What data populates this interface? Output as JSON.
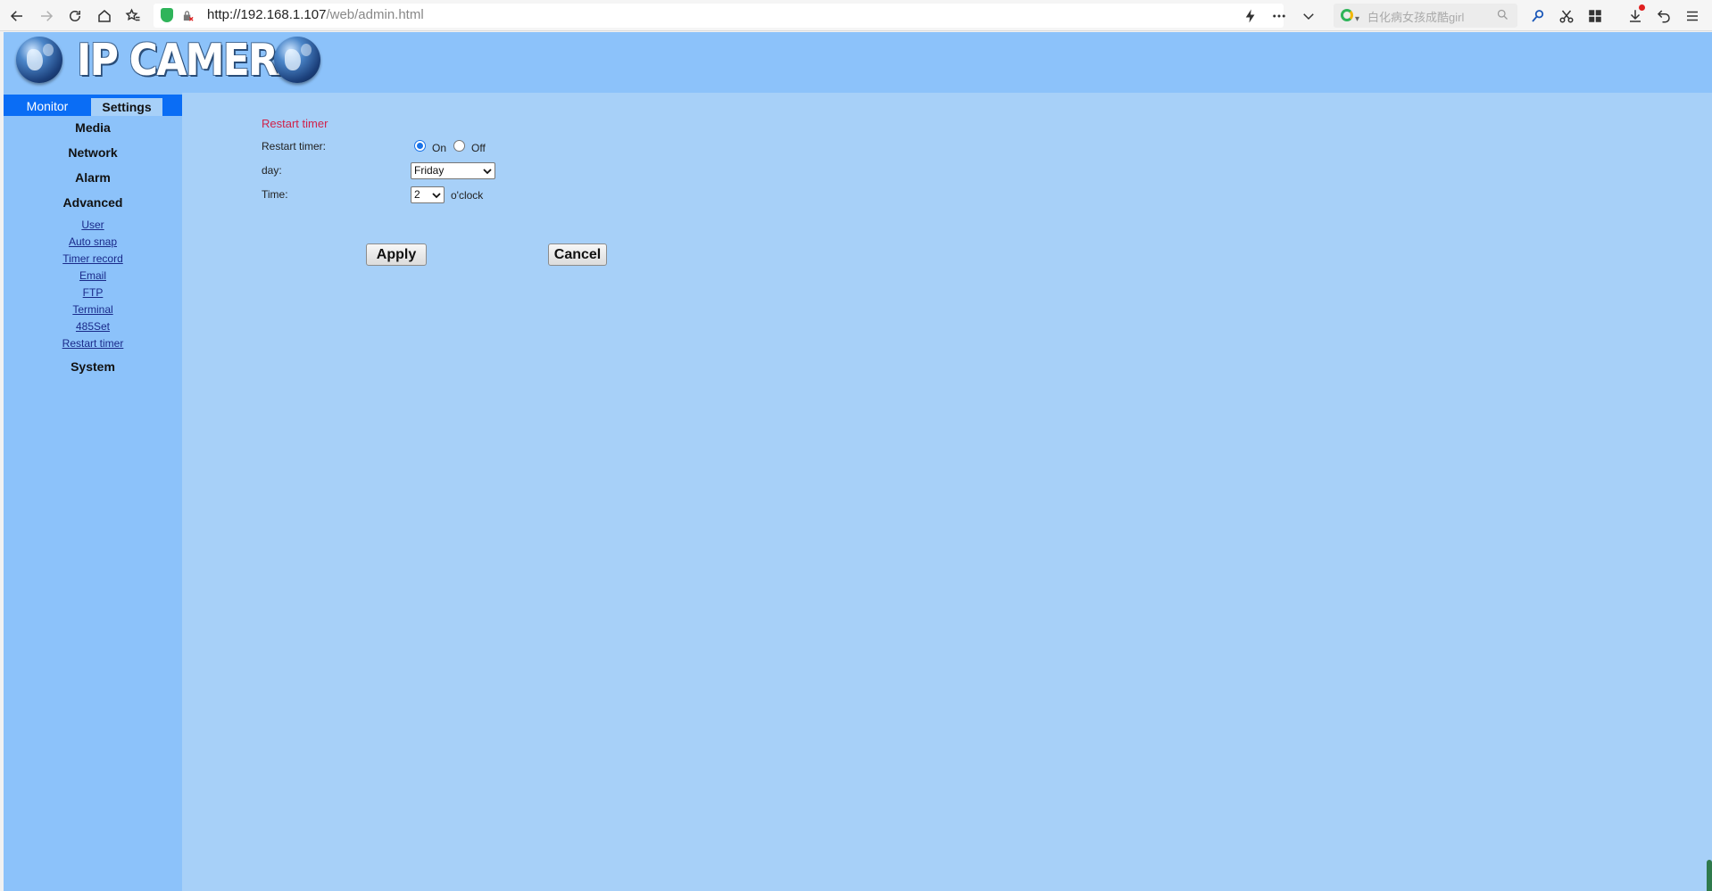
{
  "browser": {
    "url_host": "http://192.168.1.107",
    "url_path": "/web/admin.html",
    "search_placeholder": "白化病女孩成酷girl"
  },
  "header": {
    "logo_text": "IP CAMERA"
  },
  "sidebar": {
    "tabs": [
      {
        "label": "Monitor",
        "active": false
      },
      {
        "label": "Settings",
        "active": true
      }
    ],
    "menu": {
      "media": "Media",
      "network": "Network",
      "alarm": "Alarm",
      "advanced": "Advanced",
      "advanced_items": [
        "User",
        "Auto snap",
        "Timer record",
        "Email",
        "FTP",
        "Terminal",
        "485Set",
        "Restart timer"
      ],
      "system": "System"
    }
  },
  "form": {
    "section_title": "Restart timer",
    "restart_timer_label": "Restart timer:",
    "radio_on_label": "On",
    "radio_off_label": "Off",
    "restart_timer_value": "On",
    "day_label": "day:",
    "day_value": "Friday",
    "time_label": "Time:",
    "time_value": "2",
    "time_suffix": "o'clock"
  },
  "buttons": {
    "apply": "Apply",
    "cancel": "Cancel"
  },
  "colors": {
    "page_bg": "#a7d0f8",
    "sidebar_bg": "#8cc2fa",
    "tab_bar": "#0a6df5",
    "section_title": "#d0224a"
  }
}
